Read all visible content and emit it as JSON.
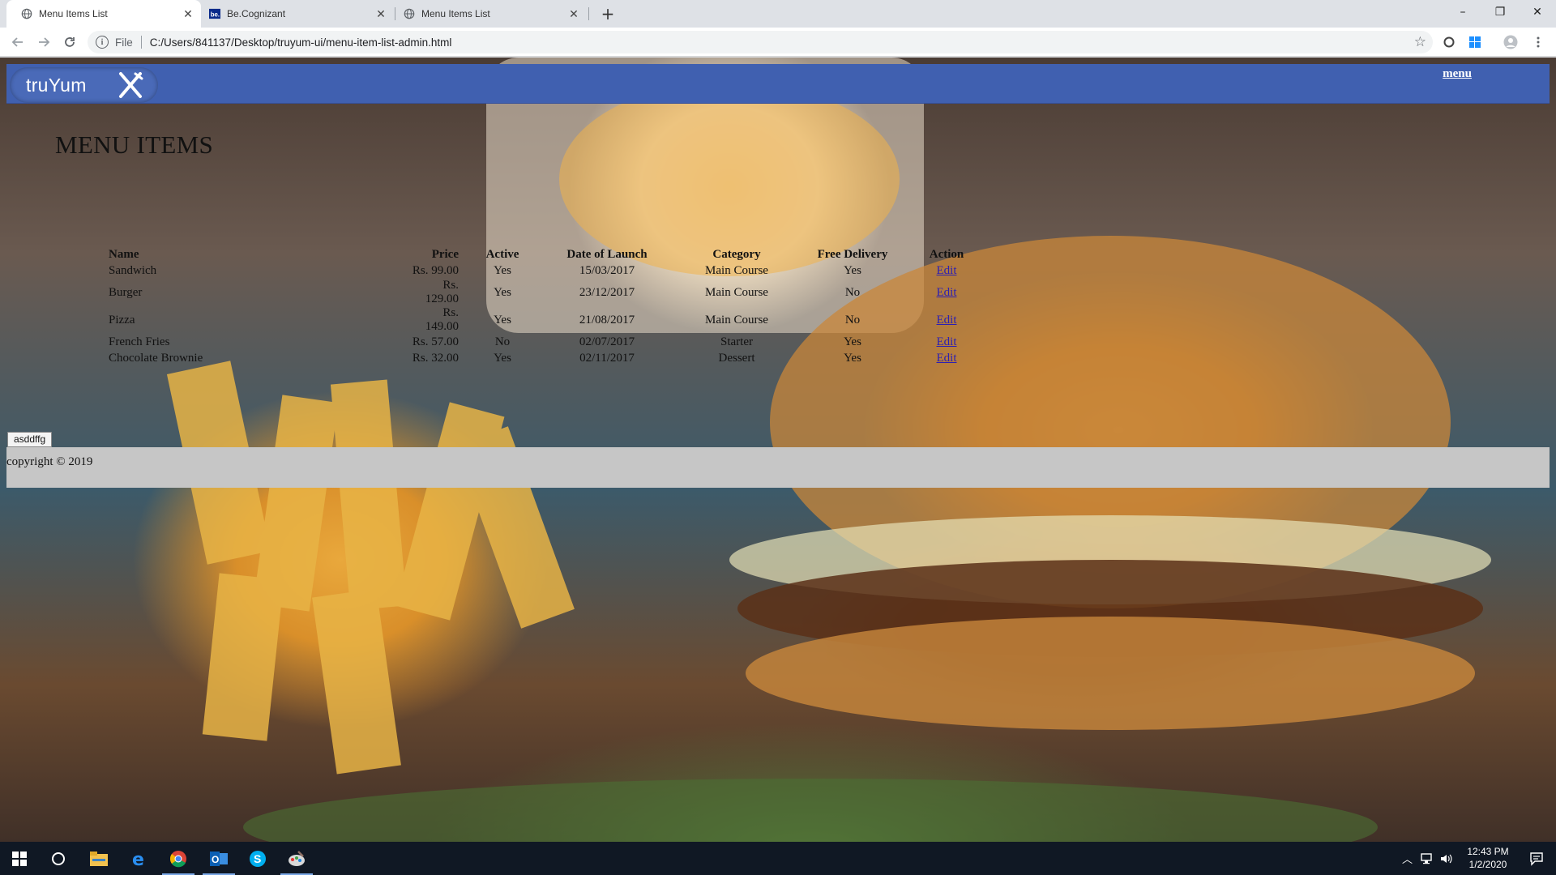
{
  "browser": {
    "tabs": [
      {
        "title": "Menu Items List",
        "active": true,
        "favicon": "globe-icon"
      },
      {
        "title": "Be.Cognizant",
        "active": false,
        "favicon": "be-cognizant-icon"
      },
      {
        "title": "Menu Items List",
        "active": false,
        "favicon": "globe-icon"
      }
    ],
    "new_tab": "+",
    "address": {
      "scheme_label": "File",
      "url": "C:/Users/841137/Desktop/truyum-ui/menu-item-list-admin.html"
    },
    "window_controls": {
      "minimize": "–",
      "restore": "❐",
      "close": "✕"
    }
  },
  "page": {
    "brand": "truYum",
    "nav_link": "menu",
    "title": "MENU ITEMS",
    "table": {
      "headers": [
        "Name",
        "Price",
        "Active",
        "Date of Launch",
        "Category",
        "Free Delivery",
        "Action"
      ],
      "rows": [
        {
          "name": "Sandwich",
          "price": "Rs. 99.00",
          "active": "Yes",
          "date": "15/03/2017",
          "category": "Main Course",
          "free_delivery": "Yes",
          "action": "Edit"
        },
        {
          "name": "Burger",
          "price": "Rs. 129.00",
          "active": "Yes",
          "date": "23/12/2017",
          "category": "Main Course",
          "free_delivery": "No",
          "action": "Edit"
        },
        {
          "name": "Pizza",
          "price": "Rs. 149.00",
          "active": "Yes",
          "date": "21/08/2017",
          "category": "Main Course",
          "free_delivery": "No",
          "action": "Edit"
        },
        {
          "name": "French Fries",
          "price": "Rs. 57.00",
          "active": "No",
          "date": "02/07/2017",
          "category": "Starter",
          "free_delivery": "Yes",
          "action": "Edit"
        },
        {
          "name": "Chocolate Brownie",
          "price": "Rs. 32.00",
          "active": "Yes",
          "date": "02/11/2017",
          "category": "Dessert",
          "free_delivery": "Yes",
          "action": "Edit"
        }
      ]
    },
    "tooltip": "asddffg",
    "footer": "copyright © 2019"
  },
  "taskbar": {
    "time": "12:43 PM",
    "date": "1/2/2020",
    "apps": [
      "windows-start-icon",
      "cortana-icon",
      "file-explorer-icon",
      "edge-icon",
      "chrome-icon",
      "outlook-icon",
      "skype-icon",
      "paint-icon"
    ]
  },
  "colors": {
    "header_bar": "#4060b0",
    "footer_bar": "#c6c6c6",
    "edit_link": "#2c1fb3",
    "taskbar": "#101824"
  }
}
